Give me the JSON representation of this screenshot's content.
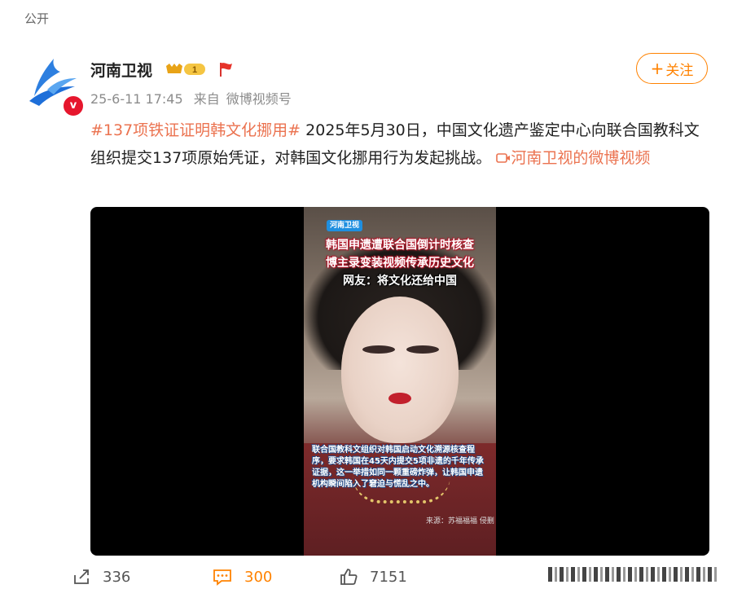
{
  "header": {
    "visibility": "公开"
  },
  "author": {
    "name": "河南卫视",
    "verified_mark": "v",
    "level": "1",
    "brand_color": "#1e6fd9"
  },
  "meta": {
    "time": "25-6-11 17:45",
    "source_prefix": "来自",
    "source": "微博视频号"
  },
  "follow_button": {
    "label": "关注"
  },
  "post": {
    "hashtag": "#137项铁证证明韩文化挪用#",
    "body": " 2025年5月30日，中国文化遗产鉴定中心向联合国教科文组织提交137项原始凭证，对韩国文化挪用行为发起挑战。",
    "video_link": "河南卫视的微博视频"
  },
  "video": {
    "logo": "河南卫视",
    "caption_line1": "韩国申遗遭联合国倒计时核查",
    "caption_line2": "博主录变装视频传承历史文化",
    "caption_line3": "网友：将文化还给中国",
    "subtitle": "联合国教科文组织对韩国启动文化溯源核查程序，要求韩国在45天内提交5项非遗的千年传承证据，这一举措如同一颗重磅炸弹，让韩国申遗机构瞬间陷入了窘迫与慌乱之中。",
    "source_credit": "来源：苏福福福 侵删"
  },
  "actions": {
    "share_count": "336",
    "comment_count": "300",
    "like_count": "7151"
  },
  "colors": {
    "accent": "#ff8200",
    "link": "#eb7350",
    "verified": "#e6162d"
  }
}
